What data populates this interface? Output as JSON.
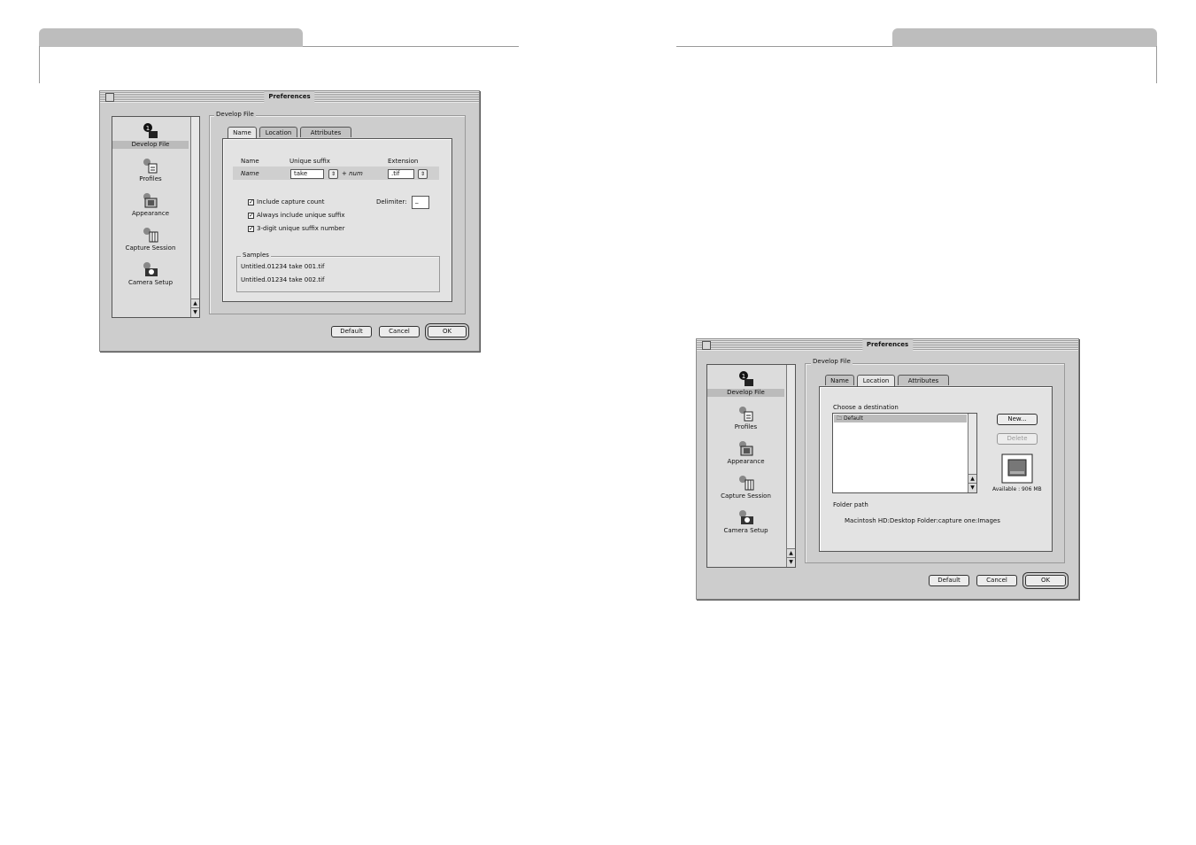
{
  "left_dialog": {
    "title": "Preferences",
    "sidebar": [
      {
        "label": "Develop File",
        "icon": "develop-file-icon",
        "active": true
      },
      {
        "label": "Profiles",
        "icon": "profiles-icon"
      },
      {
        "label": "Appearance",
        "icon": "appearance-icon"
      },
      {
        "label": "Capture Session",
        "icon": "capture-session-icon"
      },
      {
        "label": "Camera Setup",
        "icon": "camera-setup-icon"
      }
    ],
    "group_label": "Develop File",
    "tabs": [
      "Name",
      "Location",
      "Attributes"
    ],
    "active_tab": "Name",
    "name_label": "Name",
    "name_value": "Name",
    "suffix_label": "Unique suffix",
    "suffix_value": "take",
    "suffix_extra": "+ num",
    "extension_label": "Extension",
    "extension_value": ".tif",
    "checkboxes": [
      {
        "label": "Include capture count",
        "checked": true
      },
      {
        "label": "Always include unique suffix",
        "checked": true
      },
      {
        "label": "3-digit unique suffix number",
        "checked": true
      }
    ],
    "delimiter_label": "Delimiter:",
    "delimiter_value": "_",
    "samples_label": "Samples",
    "samples": [
      "Untitled.01234 take 001.tif",
      "Untitled.01234 take 002.tif"
    ],
    "buttons": {
      "default": "Default",
      "cancel": "Cancel",
      "ok": "OK"
    }
  },
  "right_dialog": {
    "title": "Preferences",
    "sidebar": [
      {
        "label": "Develop File",
        "icon": "develop-file-icon",
        "active": true
      },
      {
        "label": "Profiles",
        "icon": "profiles-icon"
      },
      {
        "label": "Appearance",
        "icon": "appearance-icon"
      },
      {
        "label": "Capture Session",
        "icon": "capture-session-icon"
      },
      {
        "label": "Camera Setup",
        "icon": "camera-setup-icon"
      }
    ],
    "group_label": "Develop File",
    "tabs": [
      "Name",
      "Location",
      "Attributes"
    ],
    "active_tab": "Location",
    "destination_label": "Choose a destination",
    "destinations": [
      "Default"
    ],
    "new_button": "New...",
    "delete_button": "Delete",
    "available": "Available : 906 MB",
    "folder_path_label": "Folder path",
    "folder_path": "Macintosh HD:Desktop Folder:capture one:Images",
    "buttons": {
      "default": "Default",
      "cancel": "Cancel",
      "ok": "OK"
    }
  },
  "colors": {
    "dialog_bg": "#cdcdcd",
    "panel_bg": "#e3e3e3",
    "page_tab": "#bdbdbd"
  }
}
